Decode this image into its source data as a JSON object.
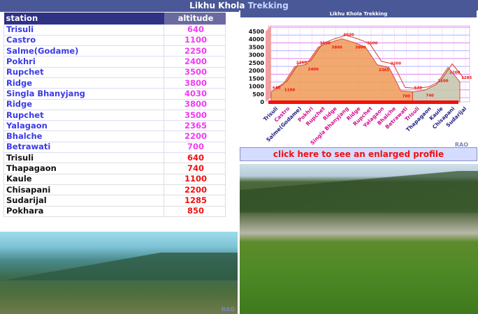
{
  "header": {
    "title_main": "Likhu Khola",
    "title_accent": "Trekking"
  },
  "table": {
    "columns": [
      "station",
      "altitude"
    ],
    "rows": [
      {
        "station": "Trisuli",
        "altitude": "640",
        "group": 1
      },
      {
        "station": "Castro",
        "altitude": "1100",
        "group": 1
      },
      {
        "station": "Salme(Godame)",
        "altitude": "2250",
        "group": 1
      },
      {
        "station": "Pokhri",
        "altitude": "2400",
        "group": 1
      },
      {
        "station": "Rupchet",
        "altitude": "3500",
        "group": 1
      },
      {
        "station": "Ridge",
        "altitude": "3800",
        "group": 1
      },
      {
        "station": "Singla Bhanyjang",
        "altitude": "4030",
        "group": 1
      },
      {
        "station": "Ridge",
        "altitude": "3800",
        "group": 1
      },
      {
        "station": "Rupchet",
        "altitude": "3500",
        "group": 1
      },
      {
        "station": "Yalagaon",
        "altitude": "2365",
        "group": 1
      },
      {
        "station": "Bhalche",
        "altitude": "2200",
        "group": 1
      },
      {
        "station": "Betrawati",
        "altitude": "700",
        "group": 1
      },
      {
        "station": "Trisuli",
        "altitude": "640",
        "group": 2
      },
      {
        "station": "Thapagaon",
        "altitude": "740",
        "group": 2
      },
      {
        "station": "Kaule",
        "altitude": "1100",
        "group": 2
      },
      {
        "station": "Chisapani",
        "altitude": "2200",
        "group": 2
      },
      {
        "station": "Sudarijal",
        "altitude": "1285",
        "group": 2
      },
      {
        "station": "Pokhara",
        "altitude": "850",
        "group": 2
      }
    ]
  },
  "chart_data": {
    "type": "area",
    "title": "Likhu Khola Trekking",
    "categories": [
      "Trisuli",
      "Castro",
      "Salme(Godame)",
      "Pokhri",
      "Rupchet",
      "Ridge",
      "Singla Bhanyjang",
      "Ridge",
      "Rupchet",
      "Yalagaon",
      "Bhalche",
      "Betrawati",
      "Trisuli",
      "Thapagaon",
      "Kaule",
      "Chisapani",
      "Sudarijal"
    ],
    "values": [
      640,
      1100,
      2250,
      2400,
      3500,
      3800,
      4030,
      3800,
      3500,
      2365,
      2200,
      700,
      640,
      740,
      1100,
      2200,
      1285
    ],
    "ylim": [
      0,
      4500
    ],
    "yticks": [
      "0",
      "500",
      "1000",
      "1500",
      "2000",
      "2500",
      "3000",
      "3500",
      "4000",
      "4500"
    ],
    "grid": true,
    "colors": {
      "segment1": "#f0a060",
      "segment2": "#c8c8b0",
      "label_navy": "#1c1c80",
      "label_magenta": "#d0108c",
      "data_label": "#f01010"
    },
    "watermark": "RAO"
  },
  "enlarge_link": "click here to see an enlarged profile",
  "watermark_photo": "RAO"
}
